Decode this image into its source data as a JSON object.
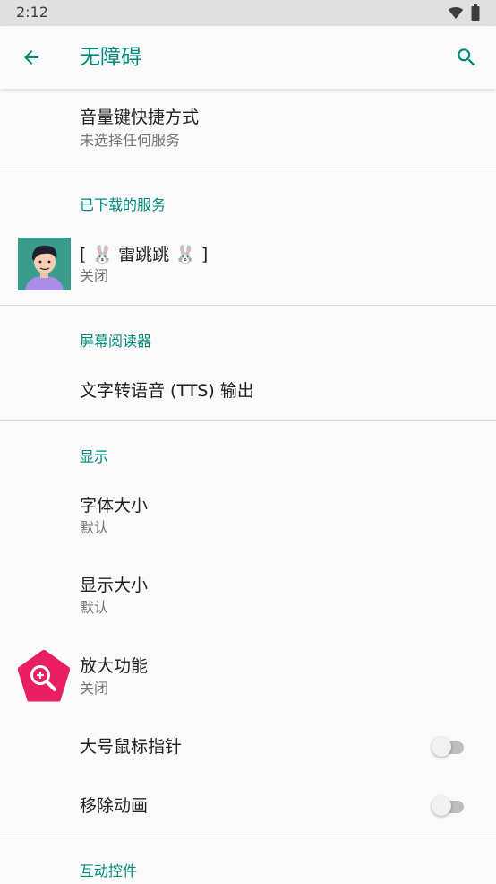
{
  "status_bar": {
    "time": "2:12"
  },
  "app_bar": {
    "title": "无障碍"
  },
  "items": {
    "volume_shortcut": {
      "title": "音量键快捷方式",
      "subtitle": "未选择任何服务"
    },
    "downloaded_header": "已下载的服务",
    "lei_tiao_tiao": {
      "title": "[ 🐰 雷跳跳 🐰 ]",
      "subtitle": "关闭"
    },
    "screen_reader_header": "屏幕阅读器",
    "tts_output": {
      "title": "文字转语音 (TTS) 输出"
    },
    "display_header": "显示",
    "font_size": {
      "title": "字体大小",
      "subtitle": "默认"
    },
    "display_size": {
      "title": "显示大小",
      "subtitle": "默认"
    },
    "magnification": {
      "title": "放大功能",
      "subtitle": "关闭"
    },
    "large_pointer": {
      "title": "大号鼠标指针",
      "enabled": false
    },
    "remove_animations": {
      "title": "移除动画",
      "enabled": false
    },
    "interaction_controls_header": "互动控件"
  },
  "colors": {
    "accent": "#00897b",
    "magnify_icon": "#e91e63"
  },
  "icons": {
    "back": "arrow-back-icon",
    "search": "search-icon",
    "wifi": "wifi-icon",
    "battery": "battery-icon",
    "avatar": "avatar-icon",
    "magnification": "magnification-icon"
  }
}
